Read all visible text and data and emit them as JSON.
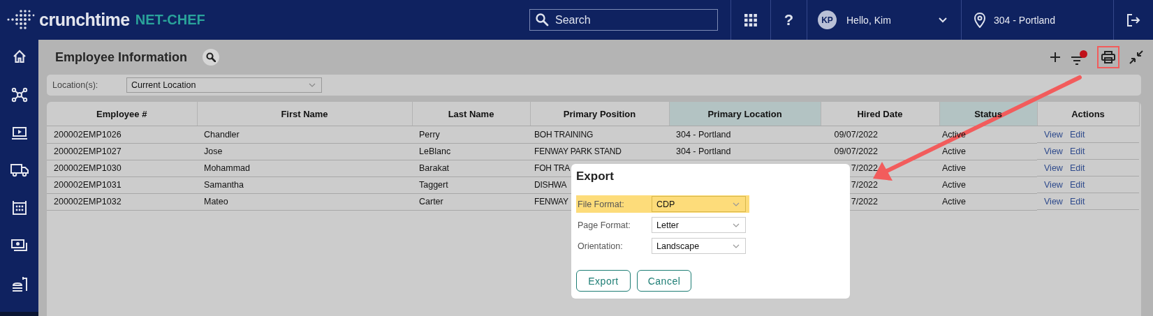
{
  "header": {
    "brand": "crunchtime",
    "product": "NET-CHEF",
    "search": {
      "placeholder": "Search"
    },
    "help": "?",
    "user": {
      "initials": "KP",
      "greeting": "Hello, Kim"
    },
    "location": "304 - Portland"
  },
  "page": {
    "title": "Employee Information",
    "filter_active": true,
    "print_highlighted": true
  },
  "filter": {
    "label": "Location(s):",
    "value": "Current Location"
  },
  "table": {
    "columns": [
      {
        "label": "Employee #",
        "highlighted": false
      },
      {
        "label": "First Name",
        "highlighted": false
      },
      {
        "label": "Last Name",
        "highlighted": false
      },
      {
        "label": "Primary Position",
        "highlighted": false
      },
      {
        "label": "Primary Location",
        "highlighted": true
      },
      {
        "label": "Hired Date",
        "highlighted": false
      },
      {
        "label": "Status",
        "highlighted": true
      },
      {
        "label": "Actions",
        "highlighted": false
      }
    ],
    "rows": [
      {
        "employee": "200002EMP1026",
        "first_name": "Chandler",
        "last_name": "Perry",
        "position": "BOH TRAINING",
        "location": "304 - Portland",
        "hired": "09/07/2022",
        "status": "Active",
        "actions": [
          "View",
          "Edit"
        ]
      },
      {
        "employee": "200002EMP1027",
        "first_name": "Jose",
        "last_name": "LeBlanc",
        "position": "FENWAY PARK STAND",
        "location": "304 - Portland",
        "hired": "09/07/2022",
        "status": "Active",
        "actions": [
          "View",
          "Edit"
        ]
      },
      {
        "employee": "200002EMP1030",
        "first_name": "Mohammad",
        "last_name": "Barakat",
        "position": "FOH TRA",
        "hired": "7/2022",
        "status": "Active",
        "actions": [
          "View",
          "Edit"
        ]
      },
      {
        "employee": "200002EMP1031",
        "first_name": "Samantha",
        "last_name": "Taggert",
        "position": "DISHWA",
        "hired": "7/2022",
        "status": "Active",
        "actions": [
          "View",
          "Edit"
        ]
      },
      {
        "employee": "200002EMP1032",
        "first_name": "Mateo",
        "last_name": "Carter",
        "position": "FENWAY",
        "hired": "7/2022",
        "status": "Active",
        "actions": [
          "View",
          "Edit"
        ]
      }
    ]
  },
  "dialog": {
    "title": "Export",
    "fields": [
      {
        "label": "File Format:",
        "value": "CDP",
        "highlighted": true
      },
      {
        "label": "Page Format:",
        "value": "Letter",
        "highlighted": false
      },
      {
        "label": "Orientation:",
        "value": "Landscape",
        "highlighted": false
      }
    ],
    "buttons": [
      "Export",
      "Cancel"
    ]
  }
}
